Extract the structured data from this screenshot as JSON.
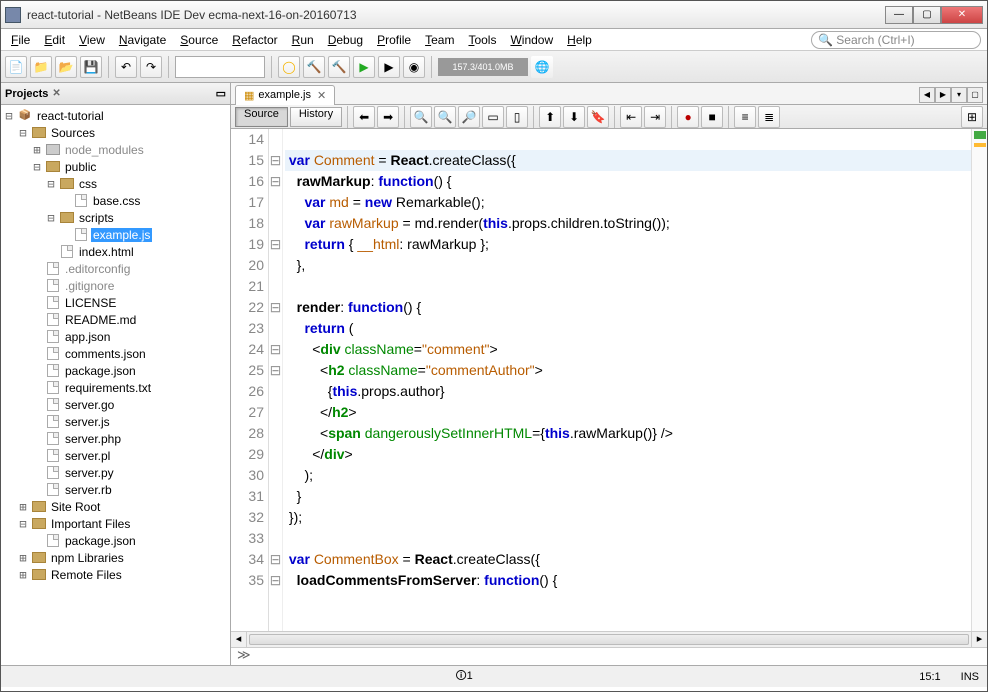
{
  "window": {
    "title": "react-tutorial - NetBeans IDE Dev ecma-next-16-on-20160713"
  },
  "menu": [
    "File",
    "Edit",
    "View",
    "Navigate",
    "Source",
    "Refactor",
    "Run",
    "Debug",
    "Profile",
    "Team",
    "Tools",
    "Window",
    "Help"
  ],
  "search_placeholder": "Search (Ctrl+I)",
  "memory": "157.3/401.0MB",
  "projects_panel": {
    "title": "Projects"
  },
  "tree": [
    {
      "d": 0,
      "exp": "⊟",
      "icon": "proj",
      "label": "react-tutorial"
    },
    {
      "d": 1,
      "exp": "⊟",
      "icon": "fold",
      "label": "Sources"
    },
    {
      "d": 2,
      "exp": "⊞",
      "icon": "foldg",
      "label": "node_modules",
      "grey": true
    },
    {
      "d": 2,
      "exp": "⊟",
      "icon": "fold",
      "label": "public"
    },
    {
      "d": 3,
      "exp": "⊟",
      "icon": "fold",
      "label": "css"
    },
    {
      "d": 4,
      "exp": "",
      "icon": "file",
      "label": "base.css"
    },
    {
      "d": 3,
      "exp": "⊟",
      "icon": "fold",
      "label": "scripts"
    },
    {
      "d": 4,
      "exp": "",
      "icon": "file",
      "label": "example.js",
      "selected": true
    },
    {
      "d": 3,
      "exp": "",
      "icon": "file",
      "label": "index.html"
    },
    {
      "d": 2,
      "exp": "",
      "icon": "file",
      "label": ".editorconfig",
      "grey": true
    },
    {
      "d": 2,
      "exp": "",
      "icon": "file",
      "label": ".gitignore",
      "grey": true
    },
    {
      "d": 2,
      "exp": "",
      "icon": "file",
      "label": "LICENSE"
    },
    {
      "d": 2,
      "exp": "",
      "icon": "file",
      "label": "README.md"
    },
    {
      "d": 2,
      "exp": "",
      "icon": "file",
      "label": "app.json"
    },
    {
      "d": 2,
      "exp": "",
      "icon": "file",
      "label": "comments.json"
    },
    {
      "d": 2,
      "exp": "",
      "icon": "file",
      "label": "package.json"
    },
    {
      "d": 2,
      "exp": "",
      "icon": "file",
      "label": "requirements.txt"
    },
    {
      "d": 2,
      "exp": "",
      "icon": "file",
      "label": "server.go"
    },
    {
      "d": 2,
      "exp": "",
      "icon": "file",
      "label": "server.js"
    },
    {
      "d": 2,
      "exp": "",
      "icon": "file",
      "label": "server.php"
    },
    {
      "d": 2,
      "exp": "",
      "icon": "file",
      "label": "server.pl"
    },
    {
      "d": 2,
      "exp": "",
      "icon": "file",
      "label": "server.py"
    },
    {
      "d": 2,
      "exp": "",
      "icon": "file",
      "label": "server.rb"
    },
    {
      "d": 1,
      "exp": "⊞",
      "icon": "fold",
      "label": "Site Root"
    },
    {
      "d": 1,
      "exp": "⊟",
      "icon": "fold",
      "label": "Important Files"
    },
    {
      "d": 2,
      "exp": "",
      "icon": "file",
      "label": "package.json"
    },
    {
      "d": 1,
      "exp": "⊞",
      "icon": "fold",
      "label": "npm Libraries"
    },
    {
      "d": 1,
      "exp": "⊞",
      "icon": "fold",
      "label": "Remote Files"
    }
  ],
  "tab": {
    "label": "example.js"
  },
  "source_history": {
    "source": "Source",
    "history": "History"
  },
  "code_lines": [
    {
      "n": 14,
      "html": ""
    },
    {
      "n": 15,
      "fold": "⊟",
      "hl": true,
      "html": "<span class='kw'>var</span> <span class='ident'>Comment</span> = <span class='func'>React</span>.createClass({"
    },
    {
      "n": 16,
      "fold": "⊟",
      "html": "  <span class='func'>rawMarkup</span>: <span class='kw'>function</span>() {"
    },
    {
      "n": 17,
      "html": "    <span class='kw'>var</span> <span class='ident'>md</span> = <span class='kw'>new</span> Remarkable();"
    },
    {
      "n": 18,
      "html": "    <span class='kw'>var</span> <span class='ident'>rawMarkup</span> = md.render(<span class='kw'>this</span>.props.children.toString());"
    },
    {
      "n": 19,
      "fold": "⊟",
      "html": "    <span class='kw'>return</span> { <span class='ident'>__html</span>: rawMarkup };"
    },
    {
      "n": 20,
      "html": "  },"
    },
    {
      "n": 21,
      "html": ""
    },
    {
      "n": 22,
      "fold": "⊟",
      "html": "  <span class='func'>render</span>: <span class='kw'>function</span>() {"
    },
    {
      "n": 23,
      "html": "    <span class='kw'>return</span> ("
    },
    {
      "n": 24,
      "fold": "⊟",
      "html": "      &lt;<span class='jsx'>div</span> <span class='jsxattr'>className</span>=<span class='str'>\"comment\"</span>&gt;"
    },
    {
      "n": 25,
      "fold": "⊟",
      "html": "        &lt;<span class='jsx'>h2</span> <span class='jsxattr'>className</span>=<span class='str'>\"commentAuthor\"</span>&gt;"
    },
    {
      "n": 26,
      "html": "          {<span class='kw'>this</span>.props.author}"
    },
    {
      "n": 27,
      "html": "        &lt;/<span class='jsx'>h2</span>&gt;"
    },
    {
      "n": 28,
      "html": "        &lt;<span class='jsx'>span</span> <span class='jsxattr'>dangerouslySetInnerHTML</span>={<span class='kw'>this</span>.rawMarkup()} /&gt;"
    },
    {
      "n": 29,
      "html": "      &lt;/<span class='jsx'>div</span>&gt;"
    },
    {
      "n": 30,
      "html": "    );"
    },
    {
      "n": 31,
      "html": "  }"
    },
    {
      "n": 32,
      "html": "});"
    },
    {
      "n": 33,
      "html": ""
    },
    {
      "n": 34,
      "fold": "⊟",
      "html": "<span class='kw'>var</span> <span class='ident'>CommentBox</span> = <span class='func'>React</span>.createClass({"
    },
    {
      "n": 35,
      "fold": "⊟",
      "html": "  <span class='func'>loadCommentsFromServer</span>: <span class='kw'>function</span>() {"
    }
  ],
  "breadcrumb": "≫",
  "status": {
    "errors": "1",
    "pos": "15:1",
    "ins": "INS"
  }
}
